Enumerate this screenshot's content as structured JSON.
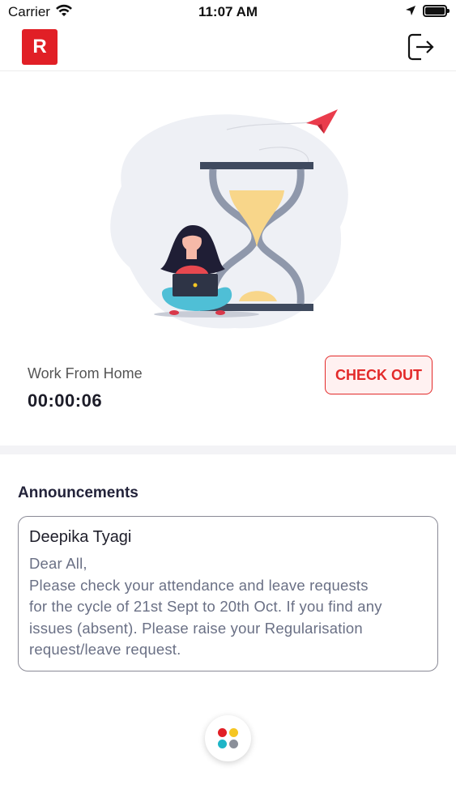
{
  "status_bar": {
    "carrier": "Carrier",
    "time": "11:07 AM"
  },
  "header": {
    "logo_letter": "R",
    "logout_icon": "logout-icon"
  },
  "attendance": {
    "mode": "Work From Home",
    "timer": "00:00:06",
    "checkout_label": "CHECK OUT"
  },
  "announcements": {
    "title": "Announcements",
    "items": [
      {
        "author": "Deepika Tyagi",
        "lines": [
          "Dear All,",
          "Please check your attendance and leave requests",
          "for the cycle of 21st Sept to 20th Oct. If you find any",
          "issues (absent). Please raise your Regularisation",
          "request/leave request."
        ]
      }
    ]
  },
  "colors": {
    "brand": "#e11f26",
    "checkout": "#e32a2a",
    "fab_dots": [
      "#e11f26",
      "#f5c623",
      "#1fb5c7",
      "#8a8f99"
    ]
  }
}
